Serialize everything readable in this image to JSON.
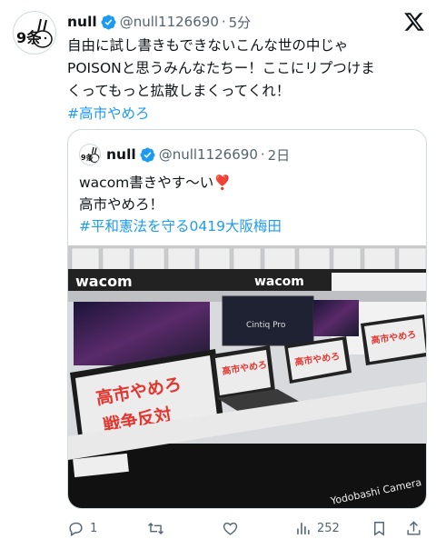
{
  "tweet": {
    "author_name": "null",
    "handle": "@null1126690",
    "separator": "·",
    "time": "5分",
    "text_line1": "自由に試し書きもできないこんな世の中じゃ",
    "text_line2": "POISONと思うみんなたちー！ここにリプつけま",
    "text_line3": "くってもっと拡散しまくってくれ！",
    "hashtag": "#高市やめろ",
    "avatar_text": "9条"
  },
  "quote": {
    "author_name": "null",
    "handle": "@null1126690",
    "separator": "·",
    "time": "2日",
    "line1": "wacom書きやす〜い",
    "line2": "高市やめろ！",
    "hashtag": "#平和憲法を守る0419大阪梅田",
    "heart_emoji": "❣️"
  },
  "photo": {
    "brand_left": "wacom",
    "brand_center": "wacom",
    "sign_main_line1": "高市やめろ",
    "sign_main_line2": "戦争反対",
    "sign_small_1": "高市やめろ",
    "sign_small_2": "高市やめろ",
    "sign_small_3": "高市やめろ",
    "banner_text": "Yodobashi Camera"
  },
  "actions": {
    "reply_count": "1",
    "retweet_count": "",
    "like_count": "",
    "views_count": "252"
  },
  "colors": {
    "accent": "#1d9bf0",
    "muted": "#536471",
    "sign_red": "#e2362f"
  }
}
